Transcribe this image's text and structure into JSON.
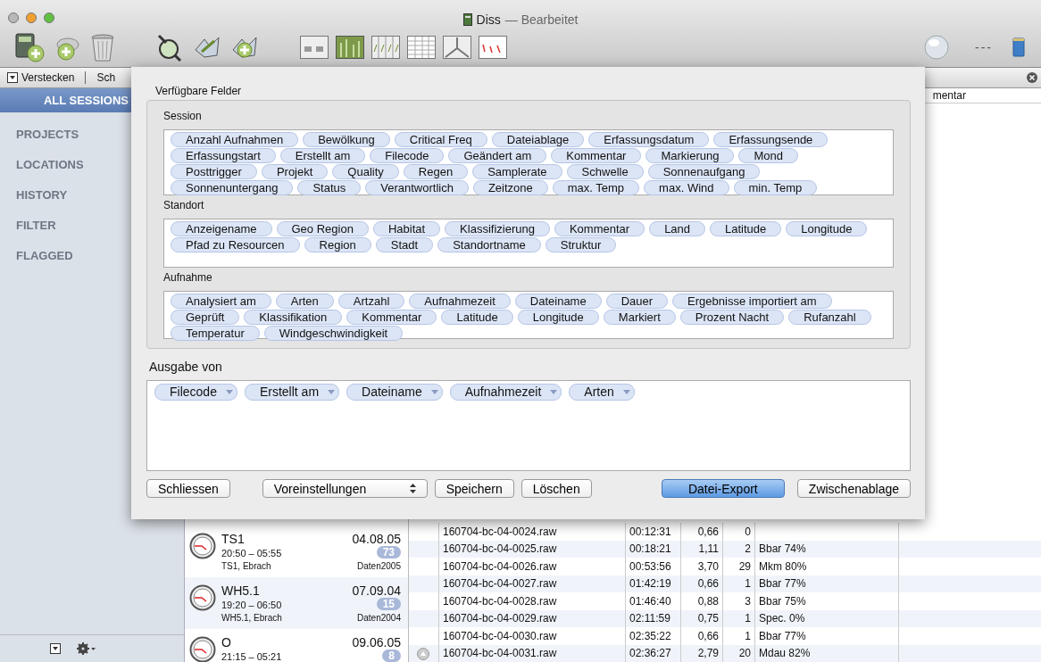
{
  "window": {
    "title": "Diss",
    "status": "— Bearbeitet"
  },
  "toolbar": {
    "right_text": "---"
  },
  "filter_bar": {
    "hide_label": "Verstecken",
    "cut_label": "Sch"
  },
  "sidebar": {
    "items": [
      {
        "label": "ALL SESSIONS",
        "selected": true
      },
      {
        "label": "PROJECTS",
        "selected": false
      },
      {
        "label": "LOCATIONS",
        "selected": false
      },
      {
        "label": "HISTORY",
        "selected": false
      },
      {
        "label": "FILTER",
        "selected": false
      },
      {
        "label": "FLAGGED",
        "selected": false
      }
    ]
  },
  "sessions": [
    {
      "name": "TS1",
      "date": "04.08.05",
      "time_range": "20:50  –  05:55",
      "count": "73",
      "location": "TS1, Ebrach",
      "folder": "Daten2005"
    },
    {
      "name": "WH5.1",
      "date": "07.09.04",
      "time_range": "19:20  –  06:50",
      "count": "15",
      "location": "WH5.1, Ebrach",
      "folder": "Daten2004"
    },
    {
      "name": "O",
      "date": "09.06.05",
      "time_range": "21:15  –  05:21",
      "count": "8"
    }
  ],
  "table": {
    "header_fragment": "mentar",
    "rows": [
      {
        "file": "160704-bc-04-0024.raw",
        "time": "00:12:31",
        "length": "0,66",
        "calls": "0"
      },
      {
        "file": "160704-bc-04-0025.raw",
        "time": "00:18:21",
        "length": "1,11",
        "calls": "2",
        "species": "Bbar 74%"
      },
      {
        "file": "160704-bc-04-0026.raw",
        "time": "00:53:56",
        "length": "3,70",
        "calls": "29",
        "species": "Mkm 80%"
      },
      {
        "file": "160704-bc-04-0027.raw",
        "time": "01:42:19",
        "length": "0,66",
        "calls": "1",
        "species": "Bbar 77%"
      },
      {
        "file": "160704-bc-04-0028.raw",
        "time": "01:46:40",
        "length": "0,88",
        "calls": "3",
        "species": "Bbar 75%"
      },
      {
        "file": "160704-bc-04-0029.raw",
        "time": "02:11:59",
        "length": "0,75",
        "calls": "1",
        "species": "Spec. 0%"
      },
      {
        "file": "160704-bc-04-0030.raw",
        "time": "02:35:22",
        "length": "0,66",
        "calls": "1",
        "species": "Bbar 77%"
      },
      {
        "file": "160704-bc-04-0031.raw",
        "time": "02:36:27",
        "length": "2,79",
        "calls": "20",
        "species": "Mdau 82%"
      }
    ]
  },
  "dialog": {
    "title": "Verfügbare Felder",
    "sections": [
      {
        "label": "Session",
        "fields": [
          "Anzahl Aufnahmen",
          "Bewölkung",
          "Critical Freq",
          "Dateiablage",
          "Erfassungsdatum",
          "Erfassungsende",
          "Erfassungstart",
          "Erstellt am",
          "Filecode",
          "Geändert am",
          "Kommentar",
          "Markierung",
          "Mond",
          "Posttrigger",
          "Projekt",
          "Quality",
          "Regen",
          "Samplerate",
          "Schwelle",
          "Sonnenaufgang",
          "Sonnenuntergang",
          "Status",
          "Verantwortlich",
          "Zeitzone",
          "max. Temp",
          "max. Wind",
          "min. Temp"
        ]
      },
      {
        "label": "Standort",
        "fields": [
          "Anzeigename",
          "Geo Region",
          "Habitat",
          "Klassifizierung",
          "Kommentar",
          "Land",
          "Latitude",
          "Longitude",
          "Pfad zu Resourcen",
          "Region",
          "Stadt",
          "Standortname",
          "Struktur"
        ]
      },
      {
        "label": "Aufnahme",
        "fields": [
          "Analysiert am",
          "Arten",
          "Artzahl",
          "Aufnahmezeit",
          "Dateiname",
          "Dauer",
          "Ergebnisse importiert am",
          "Geprüft",
          "Klassifikation",
          "Kommentar",
          "Latitude",
          "Longitude",
          "Markiert",
          "Prozent Nacht",
          "Rufanzahl",
          "Temperatur",
          "Windgeschwindigkeit"
        ]
      }
    ],
    "output_label": "Ausgabe von",
    "output_fields": [
      "Filecode",
      "Erstellt am",
      "Dateiname",
      "Aufnahmezeit",
      "Arten"
    ],
    "buttons": [
      {
        "label": "Schliessen",
        "kind": "push"
      },
      {
        "label": "Voreinstellungen",
        "kind": "popup"
      },
      {
        "label": "Speichern",
        "kind": "push"
      },
      {
        "label": "Löschen",
        "kind": "push"
      },
      {
        "label": "Datei-Export",
        "kind": "default"
      },
      {
        "label": "Zwischenablage",
        "kind": "push"
      }
    ]
  }
}
